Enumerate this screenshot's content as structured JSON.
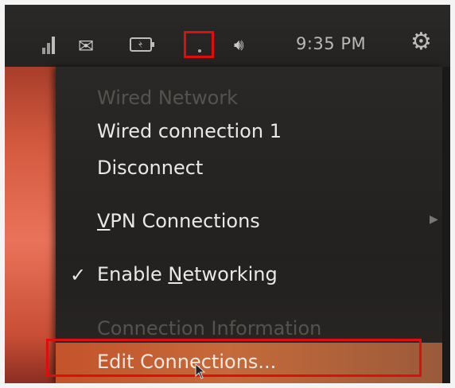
{
  "panel": {
    "clock": "9:35 PM",
    "icons": [
      "signal-icon",
      "mail-icon",
      "battery-icon",
      "network-icon",
      "sound-icon",
      "gear-icon"
    ]
  },
  "menu": {
    "header": "Wired Network",
    "wired_connection": "Wired connection 1",
    "disconnect": "Disconnect",
    "vpn_prefix": "V",
    "vpn_rest": "PN Connections",
    "enable_prefix": "Enable ",
    "enable_underlined": "N",
    "enable_rest": "etworking",
    "enable_checked": true,
    "connection_info": "Connection Information",
    "edit_connections": "Edit Connections..."
  },
  "colors": {
    "highlight_box": "#e00d0d",
    "selected_item": "#c4532a",
    "menu_bg": "#222120"
  }
}
